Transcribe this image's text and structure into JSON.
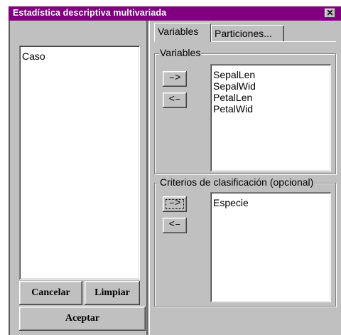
{
  "window": {
    "title": "Estadística descriptiva multivariada",
    "close_symbol": "✕",
    "title_color": "#800080"
  },
  "left_list": {
    "items": [
      "Caso"
    ]
  },
  "buttons": {
    "cancel": "Cancelar",
    "clear": "Limpiar",
    "accept": "Aceptar"
  },
  "tabs": [
    {
      "label": "Variables",
      "active": true
    },
    {
      "label": "Particiones...",
      "active": false
    }
  ],
  "variables_group": {
    "label": "Variables",
    "add_symbol": "–>",
    "remove_symbol": "<–",
    "items": [
      "SepalLen",
      "SepalWid",
      "PetalLen",
      "PetalWid"
    ]
  },
  "criteria_group": {
    "label": "Criterios de clasificación (opcional)",
    "add_symbol": "–>",
    "remove_symbol": "<–",
    "items": [
      "Especie"
    ]
  }
}
